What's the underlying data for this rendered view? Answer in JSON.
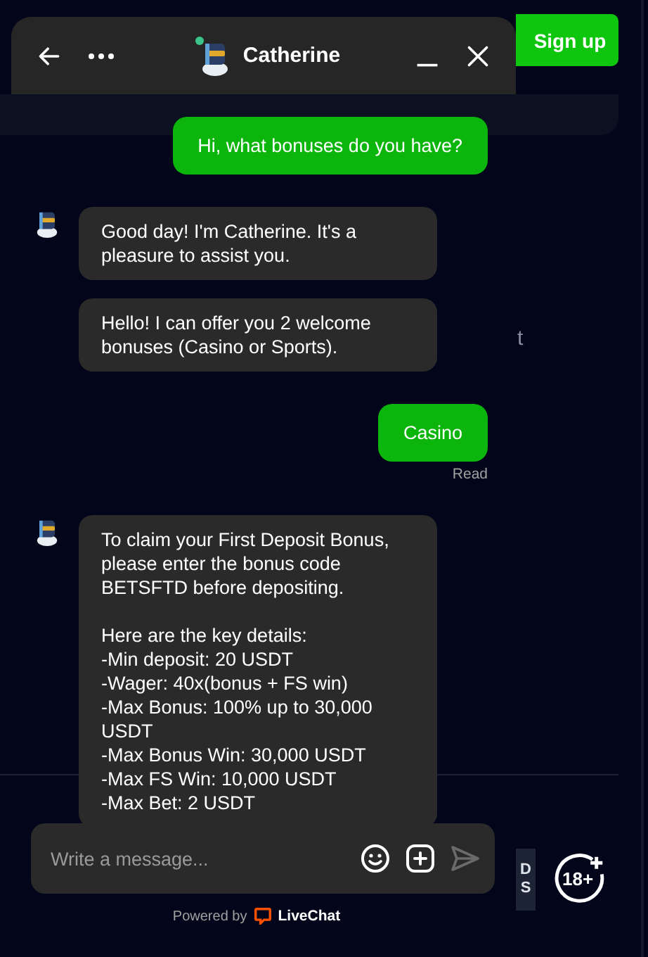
{
  "page": {
    "signup_button": "Sign up",
    "fragment_text": "t",
    "side_badge": [
      "D",
      "S"
    ],
    "age_badge": "18+"
  },
  "chat": {
    "header": {
      "title": "Catherine",
      "online": true
    },
    "messages": [
      {
        "kind": "visitor",
        "text": "Hi, what bonuses do you have?"
      },
      {
        "kind": "agent",
        "text": "Good day! I'm Catherine. It's a pleasure to assist you.",
        "avatar": true
      },
      {
        "kind": "agent",
        "text": "Hello! I can offer you 2 welcome bonuses (Casino or Sports).",
        "avatar": false
      },
      {
        "kind": "visitor",
        "text": "Casino",
        "receipt": "Read"
      },
      {
        "kind": "agent",
        "text": "To claim your First Deposit Bonus, please enter the bonus code BETSFTD before depositing.\n\nHere are the key details:\n-Min deposit: 20 USDT\n-Wager: 40x(bonus + FS win)\n-Max Bonus: 100% up to 30,000 USDT\n-Max Bonus Win: 30,000 USDT\n-Max FS Win: 10,000 USDT\n-Max Bet: 2 USDT",
        "avatar": true
      }
    ],
    "input": {
      "placeholder": "Write a message..."
    },
    "footer": {
      "prefix": "Powered by",
      "brand": "LiveChat"
    }
  }
}
